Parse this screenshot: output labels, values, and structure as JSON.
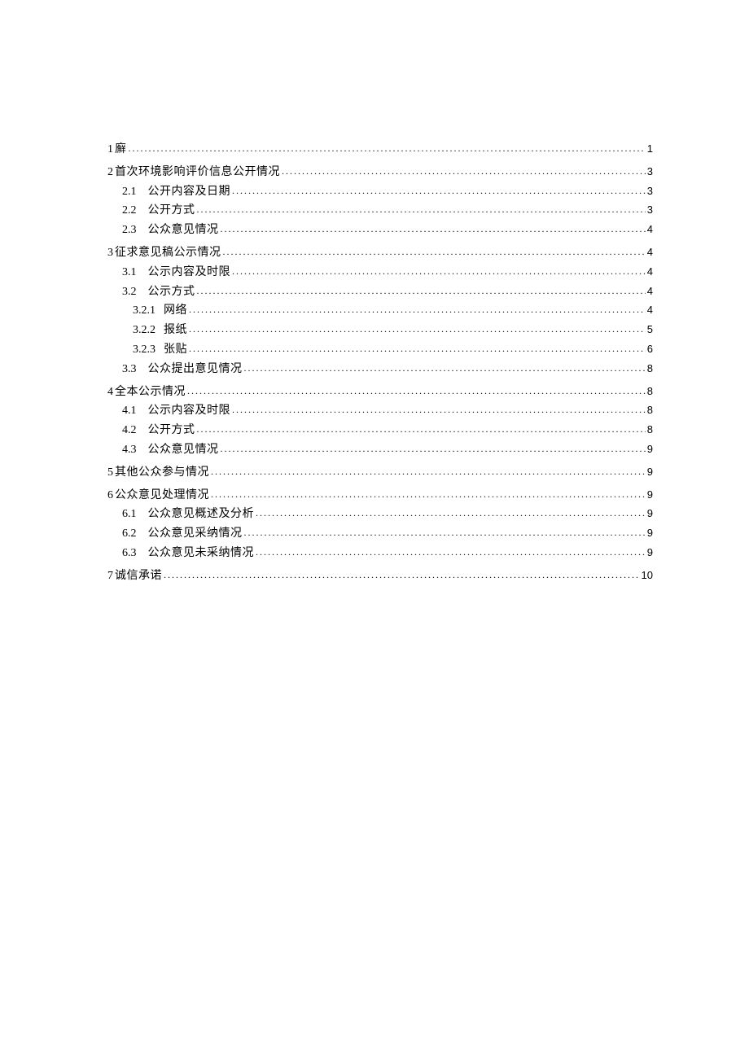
{
  "toc": [
    {
      "level": 1,
      "number": "1",
      "title": "廯",
      "page": "1"
    },
    {
      "level": 1,
      "number": "2",
      "title": "首次环境影响评价信息公开情况",
      "page": "3"
    },
    {
      "level": 2,
      "number": "2.1",
      "title": "公开内容及日期",
      "page": "3"
    },
    {
      "level": 2,
      "number": "2.2",
      "title": "公开方式",
      "page": "3"
    },
    {
      "level": 2,
      "number": "2.3",
      "title": "公众意见情况",
      "page": "4"
    },
    {
      "level": 1,
      "number": "3",
      "title": "征求意见稿公示情况",
      "page": "4"
    },
    {
      "level": 2,
      "number": "3.1",
      "title": "公示内容及时限",
      "page": "4"
    },
    {
      "level": 2,
      "number": "3.2",
      "title": "公示方式",
      "page": "4"
    },
    {
      "level": 3,
      "number": "3.2.1",
      "title": "网络",
      "page": "4"
    },
    {
      "level": 3,
      "number": "3.2.2",
      "title": "报纸",
      "page": "5"
    },
    {
      "level": 3,
      "number": "3.2.3",
      "title": "张贴",
      "page": "6"
    },
    {
      "level": 2,
      "number": "3.3",
      "title": "公众提出意见情况",
      "page": "8"
    },
    {
      "level": 1,
      "number": "4",
      "title": "全本公示情况",
      "page": "8"
    },
    {
      "level": 2,
      "number": "4.1",
      "title": "公示内容及时限",
      "page": "8"
    },
    {
      "level": 2,
      "number": "4.2",
      "title": "公开方式",
      "page": "8"
    },
    {
      "level": 2,
      "number": "4.3",
      "title": "公众意见情况",
      "page": "9"
    },
    {
      "level": 1,
      "number": "5",
      "title": "其他公众参与情况",
      "page": "9"
    },
    {
      "level": 1,
      "number": "6",
      "title": "公众意见处理情况",
      "page": "9"
    },
    {
      "level": 2,
      "number": "6.1",
      "title": "公众意见概述及分析",
      "page": "9"
    },
    {
      "level": 2,
      "number": "6.2",
      "title": "公众意见采纳情况",
      "page": "9"
    },
    {
      "level": 2,
      "number": "6.3",
      "title": "公众意见未采纳情况",
      "page": "9"
    },
    {
      "level": 1,
      "number": "7",
      "title": "诚信承诺",
      "page": "10"
    }
  ]
}
